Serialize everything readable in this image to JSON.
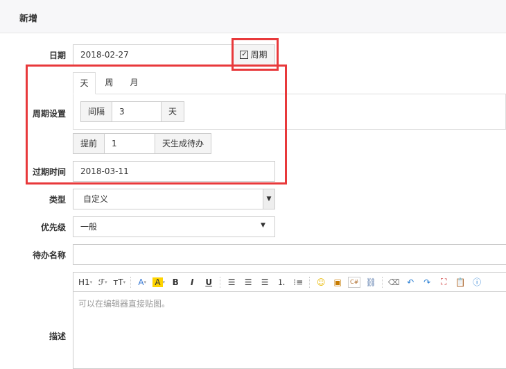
{
  "header": {
    "title": "新增"
  },
  "form": {
    "date": {
      "label": "日期",
      "value": "2018-02-27",
      "periodic_label": "周期",
      "periodic_checked": true
    },
    "cycle": {
      "label": "周期设置",
      "tabs": [
        "天",
        "周",
        "月"
      ],
      "active_tab": "天",
      "interval_label": "间隔",
      "interval_value": "3",
      "interval_unit": "天"
    },
    "advance": {
      "prefix": "提前",
      "value": "1",
      "suffix": "天生成待办"
    },
    "expire": {
      "label": "过期时间",
      "value": "2018-03-11"
    },
    "type": {
      "label": "类型",
      "value": "自定义"
    },
    "priority": {
      "label": "优先级",
      "value": "一般"
    },
    "name": {
      "label": "待办名称",
      "value": ""
    },
    "description": {
      "label": "描述",
      "placeholder": "可以在编辑器直接贴图。"
    }
  },
  "toolbar": {
    "heading": "H1",
    "font": "ℱ",
    "size": "тT",
    "color": "A",
    "bg": "A",
    "bold": "B",
    "italic": "I",
    "underline": "U"
  }
}
